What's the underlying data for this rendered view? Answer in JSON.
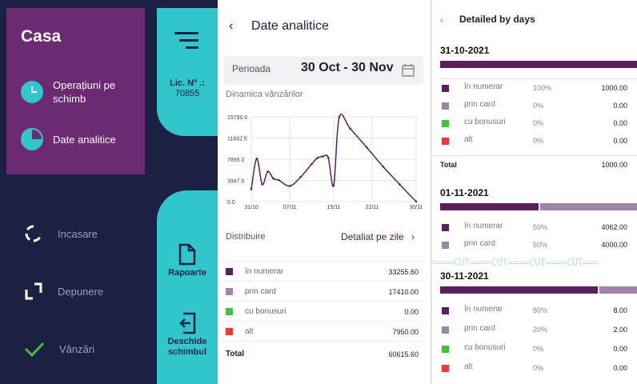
{
  "menu": {
    "brand": "Casa",
    "items": [
      {
        "label": "Operațiuni pe schimb",
        "icon": "clock-icon"
      },
      {
        "label": "Date analitice",
        "icon": "pie-chart-icon"
      }
    ],
    "lower_items": [
      {
        "label": "Incasare",
        "icon": "cash-in-icon"
      },
      {
        "label": "Depunere",
        "icon": "deposit-icon"
      },
      {
        "label": "Vânzări",
        "icon": "checkmark-icon"
      }
    ],
    "license_label": "Lic. Nº .:",
    "license_number": "70855",
    "reports_label": "Rapoarte",
    "open_shift_label": "Deschide schimbul",
    "colors": {
      "navy": "#1b2142",
      "purple": "#6b2a71",
      "teal": "#31c6cc"
    }
  },
  "analytics": {
    "title": "Date analitice",
    "period_label": "Perioada",
    "period_value": "30 Oct - 30 Nov",
    "dynamics_title": "Dinamica vânzărilor",
    "distribution_label": "Distribuire",
    "detail_link": "Detaliat pe zile",
    "rows": [
      {
        "label": "în numerar",
        "value": "33255.60",
        "color": "#5b1f5e"
      },
      {
        "label": "prin card",
        "value": "17410.00",
        "color": "#a083a9"
      },
      {
        "label": "cu bonusuri",
        "value": "0.00",
        "color": "#44c23d"
      },
      {
        "label": "alt",
        "value": "7950.00",
        "color": "#f2383c"
      }
    ],
    "total_label": "Total",
    "total_value": "60615.60"
  },
  "chart_data": {
    "type": "line",
    "title": "Dinamica vânzărilor",
    "xlabel": "",
    "ylabel": "",
    "x_ticks": [
      "31/10",
      "07/11",
      "15/11",
      "22/11",
      "30/11"
    ],
    "y_ticks": [
      "0.0",
      "3947.5",
      "7895.0",
      "11842.5",
      "15790.0"
    ],
    "ylim": [
      0,
      15790
    ],
    "series": [
      {
        "x": [
          "31/10",
          "01/11",
          "02/11",
          "03/11",
          "04/11",
          "05/11",
          "07/11",
          "09/11",
          "11/11",
          "12/11",
          "13/11",
          "14/11",
          "15/11",
          "16/11",
          "18/11",
          "21/11",
          "24/11",
          "27/11",
          "30/11"
        ],
        "values": [
          2300,
          8000,
          3200,
          5600,
          4300,
          4000,
          2900,
          4600,
          7000,
          8100,
          8400,
          8200,
          3000,
          15700,
          13600,
          10100,
          6500,
          3200,
          0
        ],
        "color": "#5b1f5e"
      }
    ],
    "grid": true
  },
  "days_panel": {
    "title": "Detailed by days",
    "cut_marker": "====CUT====CUT====CUT====CUT===",
    "total_label": "Total",
    "days": [
      {
        "date": "31-10-2021",
        "segments": [
          {
            "fraction": 1.0,
            "color": "#5b1f5e"
          }
        ],
        "rows": [
          {
            "label": "în numerar",
            "pct": "100%",
            "value": "1000.00",
            "color": "#5b1f5e"
          },
          {
            "label": "prin card",
            "pct": "0%",
            "value": "0.00",
            "color": "#a083a9"
          },
          {
            "label": "cu bonusuri",
            "pct": "0%",
            "value": "0.00",
            "color": "#44c23d"
          },
          {
            "label": "alt",
            "pct": "0%",
            "value": "0.00",
            "color": "#f2383c"
          }
        ],
        "total": "1000.00"
      },
      {
        "date": "01-11-2021",
        "segments": [
          {
            "fraction": 0.5,
            "color": "#5b1f5e"
          },
          {
            "fraction": 0.5,
            "color": "#a083a9"
          }
        ],
        "rows": [
          {
            "label": "în numerar",
            "pct": "50%",
            "value": "4062.00",
            "color": "#5b1f5e"
          },
          {
            "label": "prin card",
            "pct": "50%",
            "value": "4000.00",
            "color": "#a083a9"
          }
        ]
      },
      {
        "date": "30-11-2021",
        "segments": [
          {
            "fraction": 0.8,
            "color": "#5b1f5e"
          },
          {
            "fraction": 0.2,
            "color": "#a083a9"
          }
        ],
        "rows": [
          {
            "label": "în numerar",
            "pct": "80%",
            "value": "8.00",
            "color": "#5b1f5e"
          },
          {
            "label": "prin card",
            "pct": "20%",
            "value": "2.00",
            "color": "#a083a9"
          },
          {
            "label": "cu bonusuri",
            "pct": "0%",
            "value": "0.00",
            "color": "#44c23d"
          },
          {
            "label": "alt",
            "pct": "0%",
            "value": "0.00",
            "color": "#f2383c"
          }
        ]
      }
    ]
  }
}
